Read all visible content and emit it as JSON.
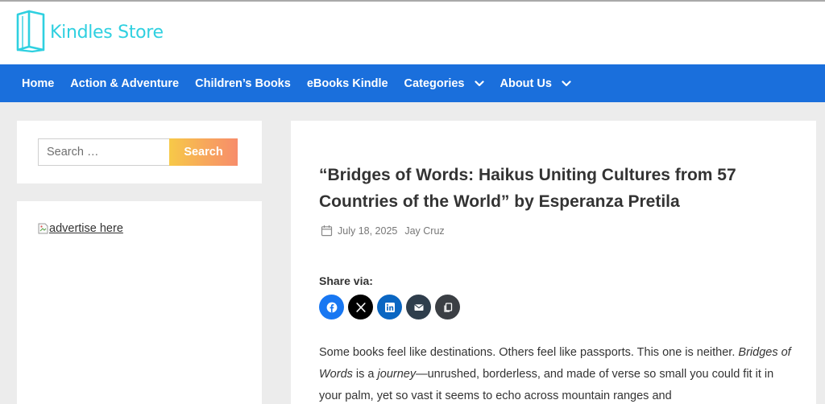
{
  "site": {
    "name": "Kindles Store",
    "logo_icon": "book-icon",
    "brand_color": "#2fd0e0"
  },
  "nav": {
    "background": "#1a6fdc",
    "items": [
      {
        "label": "Home",
        "has_dropdown": false
      },
      {
        "label": "Action & Adventure",
        "has_dropdown": false
      },
      {
        "label": "Children’s Books",
        "has_dropdown": false
      },
      {
        "label": "eBooks Kindle",
        "has_dropdown": false
      },
      {
        "label": "Categories",
        "has_dropdown": true
      },
      {
        "label": "About Us",
        "has_dropdown": true
      }
    ]
  },
  "sidebar": {
    "search": {
      "placeholder": "Search …",
      "value": "",
      "button_label": "Search"
    },
    "ad": {
      "alt_text": "advertise here"
    }
  },
  "article": {
    "title": "“Bridges of Words: Haikus Uniting Cultures from 57 Countries of the World” by Esperanza Pretila",
    "date": "July 18, 2025",
    "author": "Jay Cruz",
    "share_label": "Share via:",
    "share_buttons": [
      {
        "name": "facebook-icon",
        "color": "#1877f2"
      },
      {
        "name": "x-icon",
        "color": "#000000"
      },
      {
        "name": "linkedin-icon",
        "color": "#0a66c2"
      },
      {
        "name": "email-icon",
        "color": "#2f3e4c"
      },
      {
        "name": "copy-link-icon",
        "color": "#3b3f44"
      }
    ],
    "body": {
      "p1_start": "Some books feel like destinations. Others feel like passports. This one is neither. ",
      "p1_em1": "Bridges of Words",
      "p1_mid": " is a ",
      "p1_em2": "journey",
      "p1_end": "—unrushed, borderless, and made of verse so small you could fit it in your palm, yet so vast it seems to echo across mountain ranges and"
    }
  }
}
